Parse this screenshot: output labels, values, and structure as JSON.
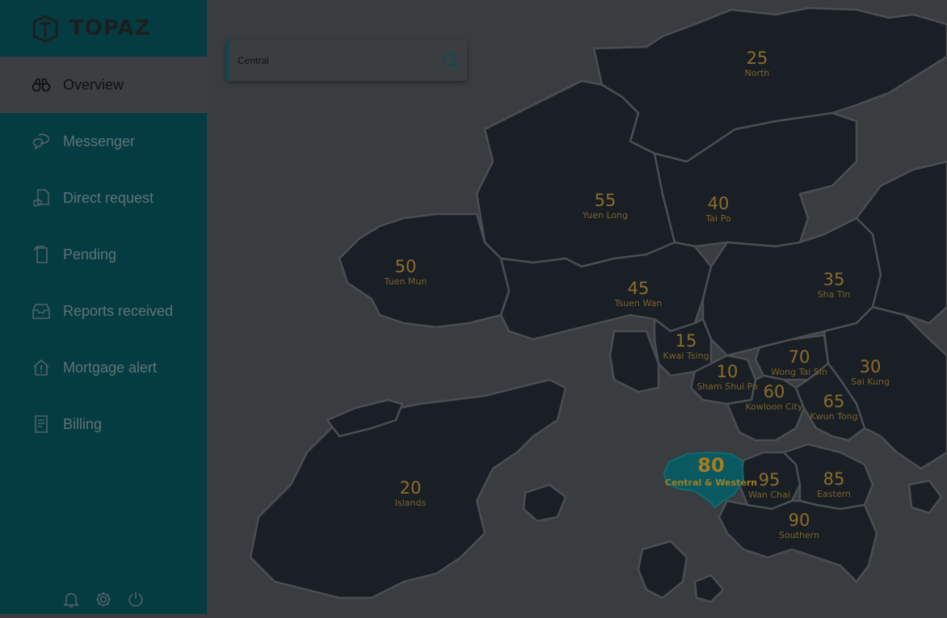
{
  "app": {
    "name": "TOPAZ"
  },
  "sidebar": {
    "items": [
      {
        "label": "Overview",
        "icon": "binoculars-icon",
        "active": true
      },
      {
        "label": "Messenger",
        "icon": "chat-bubbles-icon",
        "active": false
      },
      {
        "label": "Direct request",
        "icon": "document-hand-icon",
        "active": false
      },
      {
        "label": "Pending",
        "icon": "documents-icon",
        "active": false
      },
      {
        "label": "Reports received",
        "icon": "inbox-tray-icon",
        "active": false
      },
      {
        "label": "Mortgage alert",
        "icon": "house-alert-icon",
        "active": false
      },
      {
        "label": "Billing",
        "icon": "receipt-icon",
        "active": false
      }
    ],
    "footer_icons": [
      "bell-icon",
      "gear-icon",
      "power-icon"
    ]
  },
  "search": {
    "value": "Central",
    "icon": "search-icon"
  },
  "map": {
    "regions": [
      {
        "value": "25",
        "name": "North"
      },
      {
        "value": "55",
        "name": "Yuen Long"
      },
      {
        "value": "40",
        "name": "Tai Po"
      },
      {
        "value": "50",
        "name": "Tuen Mun"
      },
      {
        "value": "45",
        "name": "Tsuen Wan"
      },
      {
        "value": "35",
        "name": "Sha Tin"
      },
      {
        "value": "15",
        "name": "Kwai Tsing"
      },
      {
        "value": "10",
        "name": "Sham Shui Po"
      },
      {
        "value": "70",
        "name": "Wong Tai Sin"
      },
      {
        "value": "30",
        "name": "Sai Kung"
      },
      {
        "value": "60",
        "name": "Kowloon City"
      },
      {
        "value": "65",
        "name": "Kwun Tong"
      },
      {
        "value": "20",
        "name": "Islands"
      },
      {
        "value": "95",
        "name": "Wan Chai"
      },
      {
        "value": "85",
        "name": "Eastern"
      },
      {
        "value": "90",
        "name": "Southern"
      }
    ],
    "selected": {
      "value": "80",
      "name": "Central & Western"
    }
  },
  "colors": {
    "sidebar": "#053c42",
    "land": "#1a1f25",
    "water": "#3a3d40",
    "highlight": "#0b5960",
    "label": "#8b6d2c"
  }
}
